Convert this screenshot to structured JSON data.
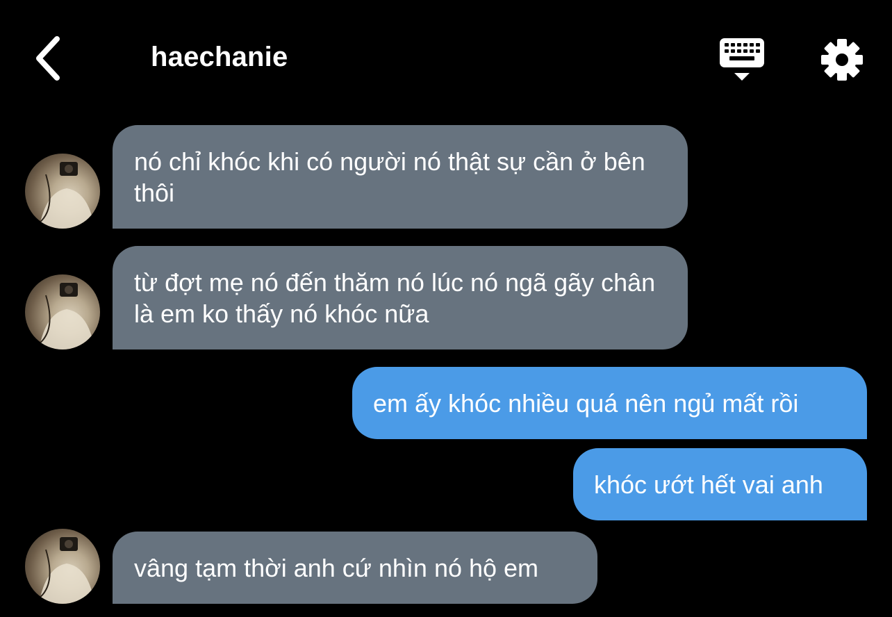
{
  "header": {
    "title": "haechanie",
    "back_icon": "chevron-left-icon",
    "keyboard_icon": "keyboard-icon",
    "settings_icon": "gear-icon"
  },
  "colors": {
    "background": "#000000",
    "received_bubble": "#67737f",
    "sent_bubble": "#4b9be7",
    "text": "#ffffff"
  },
  "messages": [
    {
      "sender": "other",
      "text": "nó chỉ khóc khi có người nó thật sự cần ở bên thôi"
    },
    {
      "sender": "other",
      "text": "từ đợt mẹ nó đến thăm nó lúc nó ngã gãy chân là em ko thấy nó khóc nữa"
    },
    {
      "sender": "me",
      "text": "em ấy khóc nhiều quá nên ngủ mất rồi"
    },
    {
      "sender": "me",
      "text": "khóc ướt hết vai anh"
    },
    {
      "sender": "other",
      "text": "vâng tạm thời anh cứ nhìn nó hộ em"
    }
  ]
}
